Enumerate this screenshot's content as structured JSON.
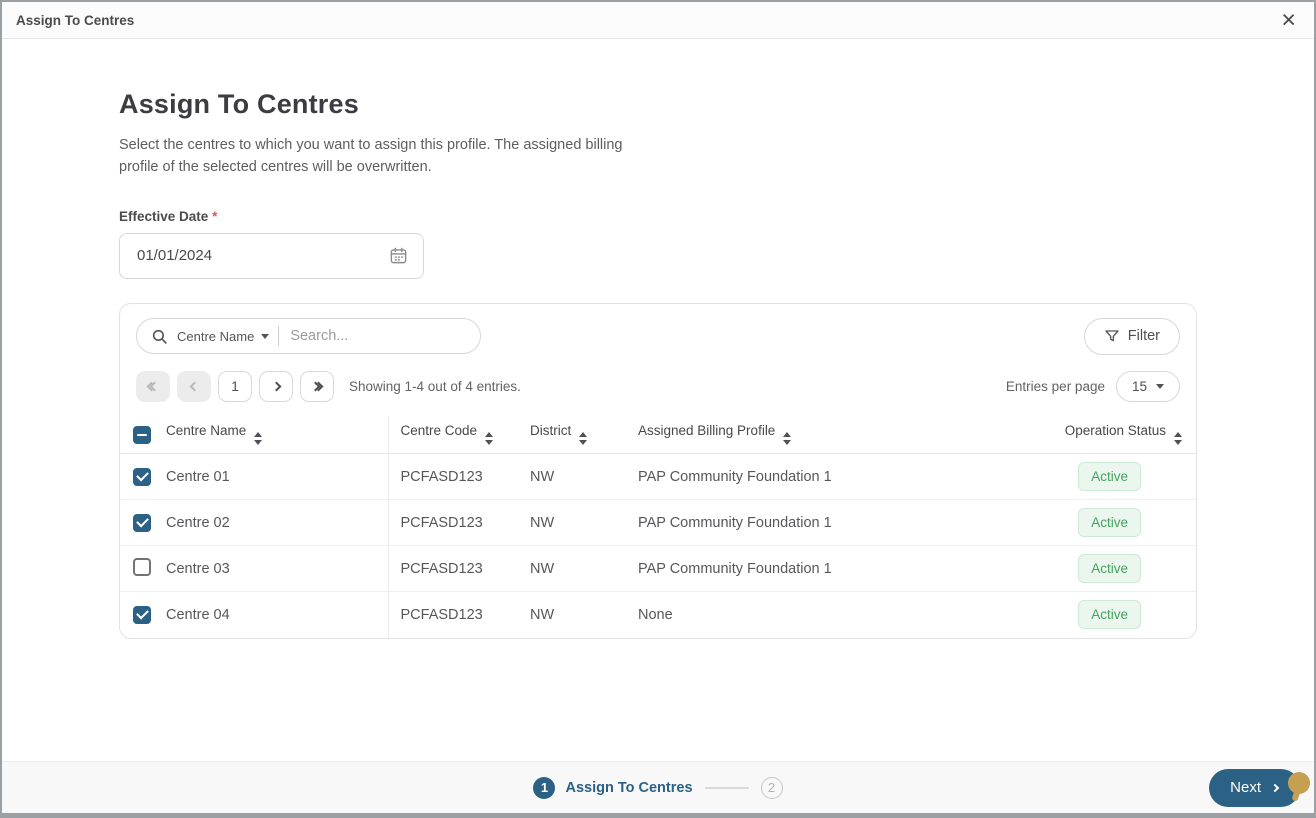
{
  "window": {
    "title": "Assign To Centres"
  },
  "icons": {
    "close": "×",
    "search": "search-icon (magnifier, css/svg)",
    "caret_down": "caret-down (css triangle)",
    "filter": "funnel-icon (svg outline)",
    "calendar": "calendar-icon (svg outline)",
    "sort": "sort-arrows (up+down triangles)",
    "chevrons": "first/prev/next/last (css chevrons)"
  },
  "header": {
    "title": "Assign To Centres",
    "description": "Select the centres to which you want to assign this profile. The assigned billing profile of the selected centres will be overwritten."
  },
  "effective_date": {
    "label": "Effective Date",
    "required_mark": "*",
    "value": "01/01/2024"
  },
  "toolbar": {
    "search_category": "Centre Name",
    "search_placeholder": "Search...",
    "filter_label": "Filter"
  },
  "pagination": {
    "current_page": "1",
    "summary": "Showing 1-4 out of 4 entries.",
    "entries_per_page_label": "Entries per page",
    "entries_per_page_value": "15"
  },
  "table": {
    "header_checkbox": "indeterminate",
    "columns": [
      "Centre Name",
      "Centre Code",
      "District",
      "Assigned Billing Profile",
      "Operation Status"
    ],
    "rows": [
      {
        "checkbox": "checked",
        "centre_name": "Centre 01",
        "centre_code": "PCFASD123",
        "district": "NW",
        "billing_profile": "PAP Community Foundation 1",
        "status": "Active"
      },
      {
        "checkbox": "checked",
        "centre_name": "Centre 02",
        "centre_code": "PCFASD123",
        "district": "NW",
        "billing_profile": "PAP Community Foundation 1",
        "status": "Active"
      },
      {
        "checkbox": "unchecked",
        "centre_name": "Centre 03",
        "centre_code": "PCFASD123",
        "district": "NW",
        "billing_profile": "PAP Community Foundation 1",
        "status": "Active"
      },
      {
        "checkbox": "checked",
        "centre_name": "Centre 04",
        "centre_code": "PCFASD123",
        "district": "NW",
        "billing_profile": "None",
        "status": "Active"
      }
    ]
  },
  "stepper": {
    "step1_number": "1",
    "step1_label": "Assign To Centres",
    "step2_number": "2"
  },
  "footer": {
    "next_label": "Next"
  },
  "colors": {
    "primary": "#2b6184",
    "badge_bg": "#eaf6ee",
    "badge_border": "#cdead6",
    "badge_text": "#44a45f",
    "required_mark": "#e25555",
    "cursor_dot": "#c5a050"
  }
}
